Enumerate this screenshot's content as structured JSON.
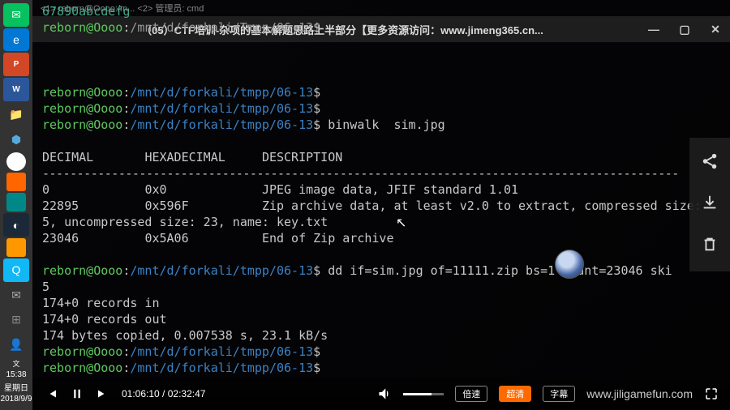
{
  "titlebar": {
    "title": "（05）CTF培训-杂项的基本解题思路上半部分【更多资源访问：www.jimeng365.cn..."
  },
  "tabs_hint": "<1> reborn@Oooo:/m...   <2> 管理员: cmd",
  "taskbar": {
    "time": "15:38",
    "day": "星期日",
    "date": "2018/9/9"
  },
  "terminal": {
    "top_overlay": "67890abcdefg",
    "prompt_user": "reborn@Oooo",
    "prompt_path": "/mnt/d/forkali/tmpp/06-13",
    "prompt_dim_path": "/mnt/d/forkali/Tmpp/06-13",
    "cmd_binwalk": " binwalk  sim.jpg",
    "hdr_dec": "DECIMAL",
    "hdr_hex": "HEXADECIMAL",
    "hdr_desc": "DESCRIPTION",
    "row1_dec": "0",
    "row1_hex": "0x0",
    "row1_desc": "JPEG image data, JFIF standard 1.01",
    "row2_dec": "22895",
    "row2_hex": "0x596F",
    "row2_desc": "Zip archive data, at least v2.0 to extract, compressed size: ",
    "row2_cont": "5, uncompressed size: 23, name: key.txt",
    "row3_dec": "23046",
    "row3_hex": "0x5A06",
    "row3_desc": "End of Zip archive",
    "cmd_dd": " dd if=sim.jpg of=11111.zip bs=1 count=23046 ski",
    "dd_cont": "5",
    "dd_out1": "174+0 records in",
    "dd_out2": "174+0 records out",
    "dd_out3": "174 bytes copied, 0.007538 s, 23.1 kB/s"
  },
  "controls": {
    "current": "01:06:10",
    "total": "02:32:47",
    "speed": "倍速",
    "quality": "超清",
    "subtitle": "字幕",
    "watermark": "www.jiligamefun.com"
  }
}
